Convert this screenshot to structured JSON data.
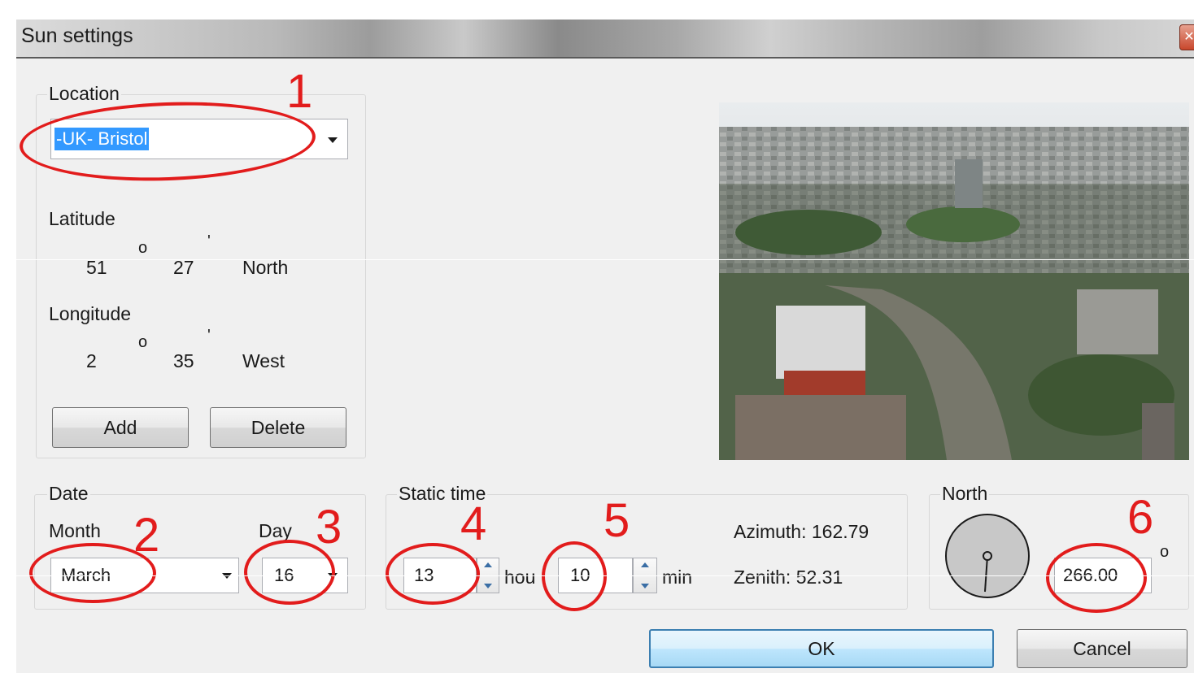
{
  "window": {
    "title": "Sun settings",
    "close_glyph": "✕"
  },
  "location": {
    "group_label": "Location",
    "selected": "-UK- Bristol",
    "latitude_label": "Latitude",
    "latitude_deg": "51",
    "latitude_min": "27",
    "latitude_dir": "North",
    "longitude_label": "Longitude",
    "longitude_deg": "2",
    "longitude_min": "35",
    "longitude_dir": "West",
    "degree_mark": "o",
    "minute_mark": "'",
    "add_label": "Add",
    "delete_label": "Delete"
  },
  "date": {
    "group_label": "Date",
    "month_label": "Month",
    "day_label": "Day",
    "month_value": "March",
    "day_value": "16"
  },
  "static_time": {
    "group_label": "Static time",
    "hours_value": "13",
    "hours_unit": "hou",
    "minutes_value": "10",
    "minutes_unit": "min",
    "azimuth": "Azimuth: 162.79",
    "zenith": "Zenith: 52.31"
  },
  "north": {
    "group_label": "North",
    "value": "266.00",
    "degree_mark": "o"
  },
  "buttons": {
    "ok": "OK",
    "cancel": "Cancel"
  },
  "annotations": [
    "1",
    "2",
    "3",
    "4",
    "5",
    "6"
  ],
  "colors": {
    "annotation": "#e21c1c",
    "selection": "#3399ff",
    "default_button_border": "#3c7fb1"
  },
  "icons": [
    "close-icon",
    "dropdown-arrow-icon",
    "spin-up-icon",
    "spin-down-icon",
    "compass-dial-icon"
  ]
}
